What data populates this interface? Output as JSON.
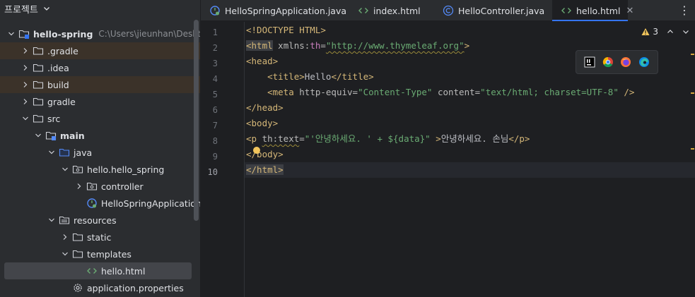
{
  "project_panel": {
    "title": "프로젝트",
    "tree": [
      {
        "label": "hello-spring",
        "path": "C:\\Users\\jieunhan\\Desktop\\",
        "icon": "module-folder-icon",
        "expanded": true,
        "bold": true
      },
      {
        "label": ".gradle",
        "icon": "folder-icon",
        "expanded": false,
        "excluded": true
      },
      {
        "label": ".idea",
        "icon": "folder-icon",
        "expanded": false
      },
      {
        "label": "build",
        "icon": "folder-icon",
        "expanded": false,
        "excluded": true
      },
      {
        "label": "gradle",
        "icon": "folder-icon",
        "expanded": false
      },
      {
        "label": "src",
        "icon": "folder-icon",
        "expanded": true
      },
      {
        "label": "main",
        "icon": "source-folder-icon",
        "expanded": true,
        "bold": true
      },
      {
        "label": "java",
        "icon": "java-source-folder-icon",
        "expanded": true
      },
      {
        "label": "hello.hello_spring",
        "icon": "package-icon",
        "expanded": true
      },
      {
        "label": "controller",
        "icon": "package-icon",
        "expanded": false
      },
      {
        "label": "HelloSpringApplication",
        "icon": "spring-boot-class-icon"
      },
      {
        "label": "resources",
        "icon": "resources-folder-icon",
        "expanded": true
      },
      {
        "label": "static",
        "icon": "folder-icon",
        "expanded": false
      },
      {
        "label": "templates",
        "icon": "folder-icon",
        "expanded": true
      },
      {
        "label": "hello.html",
        "icon": "html-file-icon",
        "selected": true
      },
      {
        "label": "application.properties",
        "icon": "settings-file-icon"
      }
    ]
  },
  "tabs": [
    {
      "label": "HelloSpringApplication.java",
      "icon": "spring-boot-class-icon",
      "active": false
    },
    {
      "label": "index.html",
      "icon": "html-file-icon",
      "active": false
    },
    {
      "label": "HelloController.java",
      "icon": "class-icon",
      "active": false
    },
    {
      "label": "hello.html",
      "icon": "html-file-icon",
      "active": true
    }
  ],
  "tab_close_label": "✕",
  "more_menu_label": "⋮",
  "editor": {
    "warning_count": "3",
    "current_line": 10,
    "line_numbers": [
      "1",
      "2",
      "3",
      "4",
      "5",
      "6",
      "7",
      "8",
      "9",
      "10"
    ],
    "lines": [
      [
        {
          "t": "<!DOCTYPE HTML>",
          "c": "kw"
        }
      ],
      [
        {
          "t": "<html",
          "c": "kw hl"
        },
        {
          "t": " xmlns:",
          "c": "attr"
        },
        {
          "t": "th",
          "c": "ns"
        },
        {
          "t": "=",
          "c": "attr"
        },
        {
          "t": "\"http://www.thymeleaf.org\"",
          "c": "str squig"
        },
        {
          "t": ">",
          "c": "kw"
        }
      ],
      [
        {
          "t": "<head>",
          "c": "kw"
        }
      ],
      [
        {
          "t": "    <title>",
          "c": "kw"
        },
        {
          "t": "Hello",
          "c": ""
        },
        {
          "t": "</title>",
          "c": "kw"
        }
      ],
      [
        {
          "t": "    <meta ",
          "c": "kw"
        },
        {
          "t": "http-equiv",
          "c": "attr"
        },
        {
          "t": "=",
          "c": "attr"
        },
        {
          "t": "\"Content-Type\"",
          "c": "str"
        },
        {
          "t": " content",
          "c": "attr"
        },
        {
          "t": "=",
          "c": "attr"
        },
        {
          "t": "\"text/html; charset=UTF-8\"",
          "c": "str"
        },
        {
          "t": " />",
          "c": "kw"
        }
      ],
      [
        {
          "t": "</head>",
          "c": "kw"
        }
      ],
      [
        {
          "t": "<body>",
          "c": "kw"
        }
      ],
      [
        {
          "t": "<p ",
          "c": "kw"
        },
        {
          "t": "th:text",
          "c": "attr squig"
        },
        {
          "t": "=",
          "c": "attr"
        },
        {
          "t": "\"'안녕하세요. ' + ${data}\"",
          "c": "str"
        },
        {
          "t": " >",
          "c": "kw"
        },
        {
          "t": "안녕하세요. 손님",
          "c": ""
        },
        {
          "t": "</p>",
          "c": "kw"
        }
      ],
      [
        {
          "t": "</body>",
          "c": "kw"
        }
      ],
      [
        {
          "t": "</html>",
          "c": "kw hl"
        }
      ]
    ]
  },
  "browser_popup": [
    "intellij-icon",
    "chrome-icon",
    "firefox-icon",
    "edge-icon"
  ],
  "colors": {
    "accent": "#3574f0",
    "excluded_bg": "#3b3229",
    "selected_bg": "#43454a"
  }
}
